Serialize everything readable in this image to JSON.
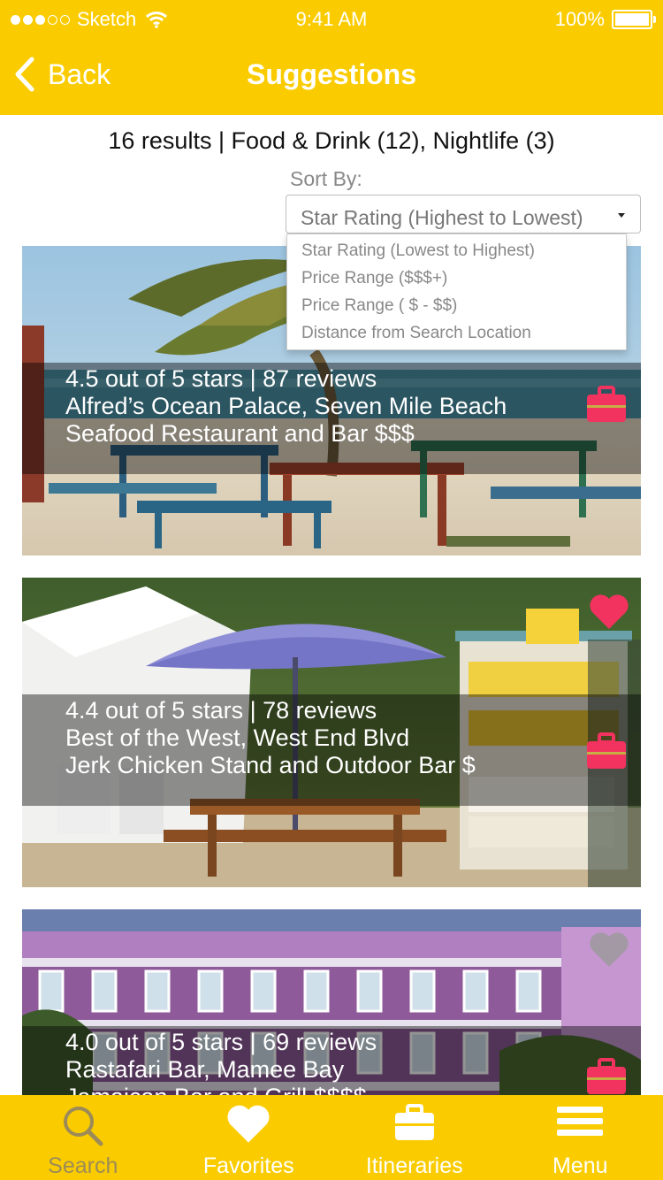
{
  "status_bar": {
    "carrier": "Sketch",
    "time": "9:41 AM",
    "battery": "100%"
  },
  "nav": {
    "back_label": "Back",
    "title": "Suggestions"
  },
  "results_summary": "16 results | Food & Drink (12), Nightlife (3)",
  "sort": {
    "label": "Sort By:",
    "selected": "Star Rating (Highest to Lowest)",
    "options": [
      "Star Rating (Lowest to Highest)",
      "Price Range ($$$+)",
      "Price Range ( $ - $$)",
      "Distance from Search Location"
    ]
  },
  "cards": [
    {
      "rating": "4.5 out of 5 stars | 87 reviews",
      "name": "Alfred’s Ocean Palace, Seven Mile Beach",
      "category": "Seafood Restaurant and Bar  $$$",
      "favorited": false
    },
    {
      "rating": "4.4 out of 5 stars | 78 reviews",
      "name": "Best of the West, West End Blvd",
      "category": "Jerk Chicken Stand and Outdoor Bar $",
      "favorited": true
    },
    {
      "rating": "4.0 out of 5 stars | 69 reviews",
      "name": "Rastafari Bar, Mamee Bay",
      "category": "Jamaican Bar and Grill $$$$",
      "favorited": false
    }
  ],
  "colors": {
    "brand_yellow": "#FACC00",
    "accent_pink": "#F2325F",
    "tab_inactive": "#9C8B58"
  },
  "tabs": [
    {
      "label": "Search",
      "icon": "search-icon",
      "active": true
    },
    {
      "label": "Favorites",
      "icon": "heart-icon",
      "active": false
    },
    {
      "label": "Itineraries",
      "icon": "briefcase-icon",
      "active": false
    },
    {
      "label": "Menu",
      "icon": "menu-icon",
      "active": false
    }
  ]
}
